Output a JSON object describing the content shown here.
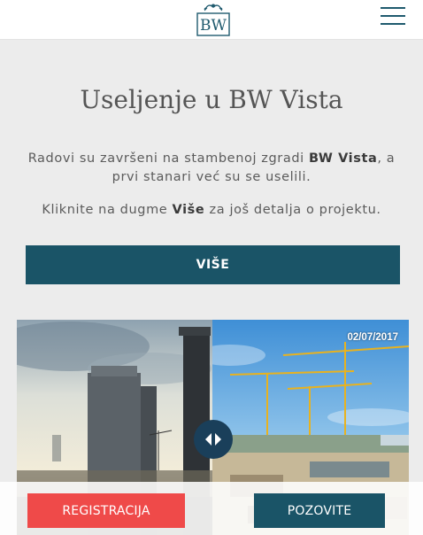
{
  "header": {
    "logo_text": "BW",
    "menu_icon": "hamburger-menu-icon",
    "brand_color": "#1f5a6e"
  },
  "hero": {
    "title": "Useljenje u BW Vista",
    "para1_pre": "Radovi su završeni na stambenoj zgradi ",
    "para1_bold": "BW Vista",
    "para1_post": ", a prvi stanari već su se uselili.",
    "para2_pre": "Kliknite na dugme ",
    "para2_bold": "Više",
    "para2_post": " za još detalja o projektu.",
    "vise_label": "VIŠE"
  },
  "slider": {
    "date_label": "02/07/2017",
    "handle_icon": "left-right-arrows-icon"
  },
  "bottom_bar": {
    "registracija_label": "REGISTRACIJA",
    "pozovite_label": "POZOVITE",
    "registracija_color": "#ef4a49",
    "pozovite_color": "#1a5467"
  }
}
